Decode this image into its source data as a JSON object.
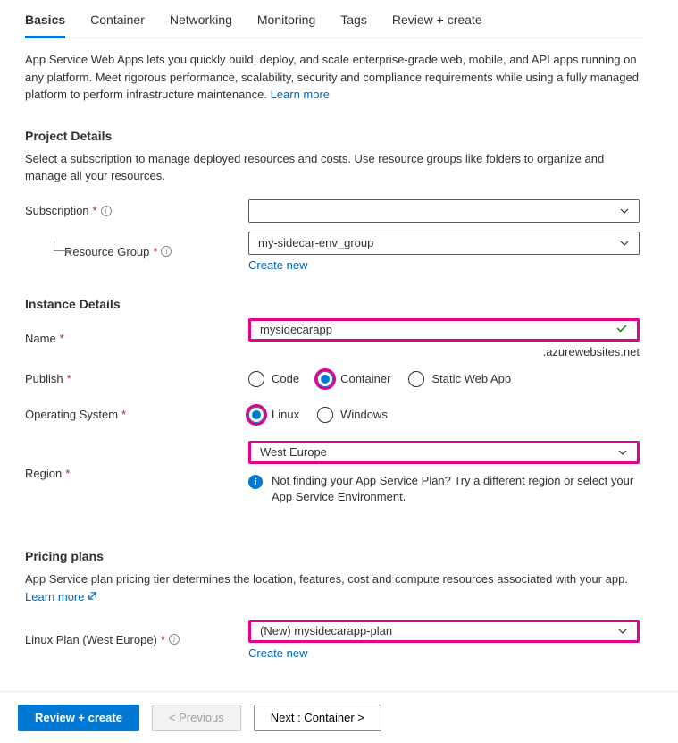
{
  "tabs": [
    "Basics",
    "Container",
    "Networking",
    "Monitoring",
    "Tags",
    "Review + create"
  ],
  "activeTabIndex": 0,
  "intro": {
    "text": "App Service Web Apps lets you quickly build, deploy, and scale enterprise-grade web, mobile, and API apps running on any platform. Meet rigorous performance, scalability, security and compliance requirements while using a fully managed platform to perform infrastructure maintenance.  ",
    "learnMore": "Learn more"
  },
  "projectDetails": {
    "title": "Project Details",
    "desc": "Select a subscription to manage deployed resources and costs. Use resource groups like folders to organize and manage all your resources.",
    "subscriptionLabel": "Subscription",
    "subscriptionValue": "",
    "resourceGroupLabel": "Resource Group",
    "resourceGroupValue": "my-sidecar-env_group",
    "createNew": "Create new"
  },
  "instanceDetails": {
    "title": "Instance Details",
    "nameLabel": "Name",
    "nameValue": "mysidecarapp",
    "domainSuffix": ".azurewebsites.net",
    "publishLabel": "Publish",
    "publishOptions": [
      "Code",
      "Container",
      "Static Web App"
    ],
    "publishSelected": "Container",
    "osLabel": "Operating System",
    "osOptions": [
      "Linux",
      "Windows"
    ],
    "osSelected": "Linux",
    "regionLabel": "Region",
    "regionValue": "West Europe",
    "regionHint": "Not finding your App Service Plan? Try a different region or select your App Service Environment."
  },
  "pricingPlans": {
    "title": "Pricing plans",
    "desc": "App Service plan pricing tier determines the location, features, cost and compute resources associated with your app.",
    "learnMore": "Learn more",
    "linuxPlanLabel": "Linux Plan (West Europe)",
    "linuxPlanValue": "(New) mysidecarapp-plan",
    "createNew": "Create new"
  },
  "footer": {
    "reviewCreate": "Review + create",
    "previous": "< Previous",
    "next": "Next : Container >"
  }
}
